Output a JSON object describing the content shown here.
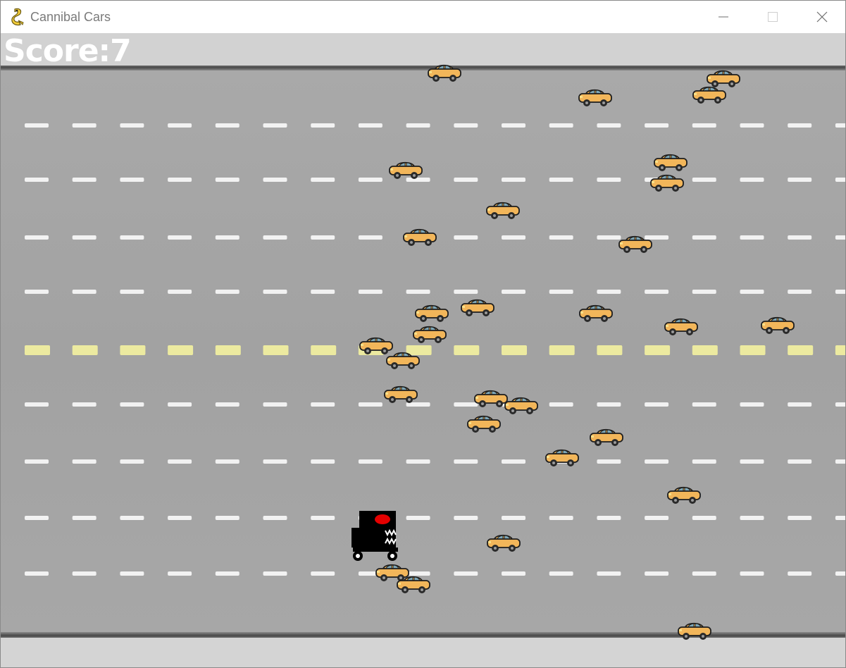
{
  "window": {
    "title": "Cannibal Cars",
    "icon": "python-snake-icon",
    "controls": [
      "minimize-icon",
      "maximize-icon",
      "close-icon"
    ]
  },
  "hud": {
    "score_text": "Score:7"
  },
  "colors": {
    "road": "#a5a5a5",
    "shoulder": "#d3d3d3",
    "lane_marking": "#ffffff",
    "center_marking": "#f4f2a0",
    "taxi": "#f2b65a",
    "player_body": "#000000",
    "player_eye": "#e00000"
  },
  "sprites": {
    "player": "black-cannibal-car-with-red-eye-and-teeth",
    "enemy": "yellow-taxi-car"
  }
}
